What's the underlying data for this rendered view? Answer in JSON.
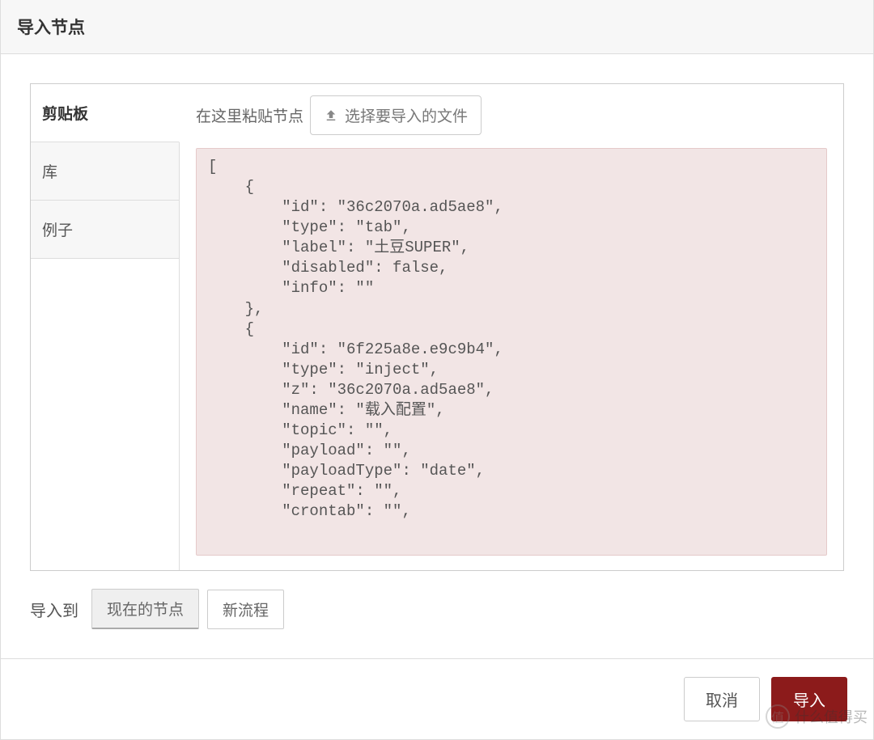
{
  "header": {
    "title": "导入节点"
  },
  "sidebar": {
    "tabs": [
      {
        "label": "剪贴板"
      },
      {
        "label": "库"
      },
      {
        "label": "例子"
      }
    ]
  },
  "content": {
    "paste_hint": "在这里粘贴节点",
    "file_button": "选择要导入的文件",
    "textarea_value": "[\n    {\n        \"id\": \"36c2070a.ad5ae8\",\n        \"type\": \"tab\",\n        \"label\": \"土豆SUPER\",\n        \"disabled\": false,\n        \"info\": \"\"\n    },\n    {\n        \"id\": \"6f225a8e.e9c9b4\",\n        \"type\": \"inject\",\n        \"z\": \"36c2070a.ad5ae8\",\n        \"name\": \"载入配置\",\n        \"topic\": \"\",\n        \"payload\": \"\",\n        \"payloadType\": \"date\",\n        \"repeat\": \"\",\n        \"crontab\": \"\","
  },
  "import_to": {
    "label": "导入到",
    "option_current": "现在的节点",
    "option_new": "新流程"
  },
  "footer": {
    "cancel": "取消",
    "import": "导入"
  },
  "watermark": {
    "char": "值",
    "text": "什么值得买"
  }
}
